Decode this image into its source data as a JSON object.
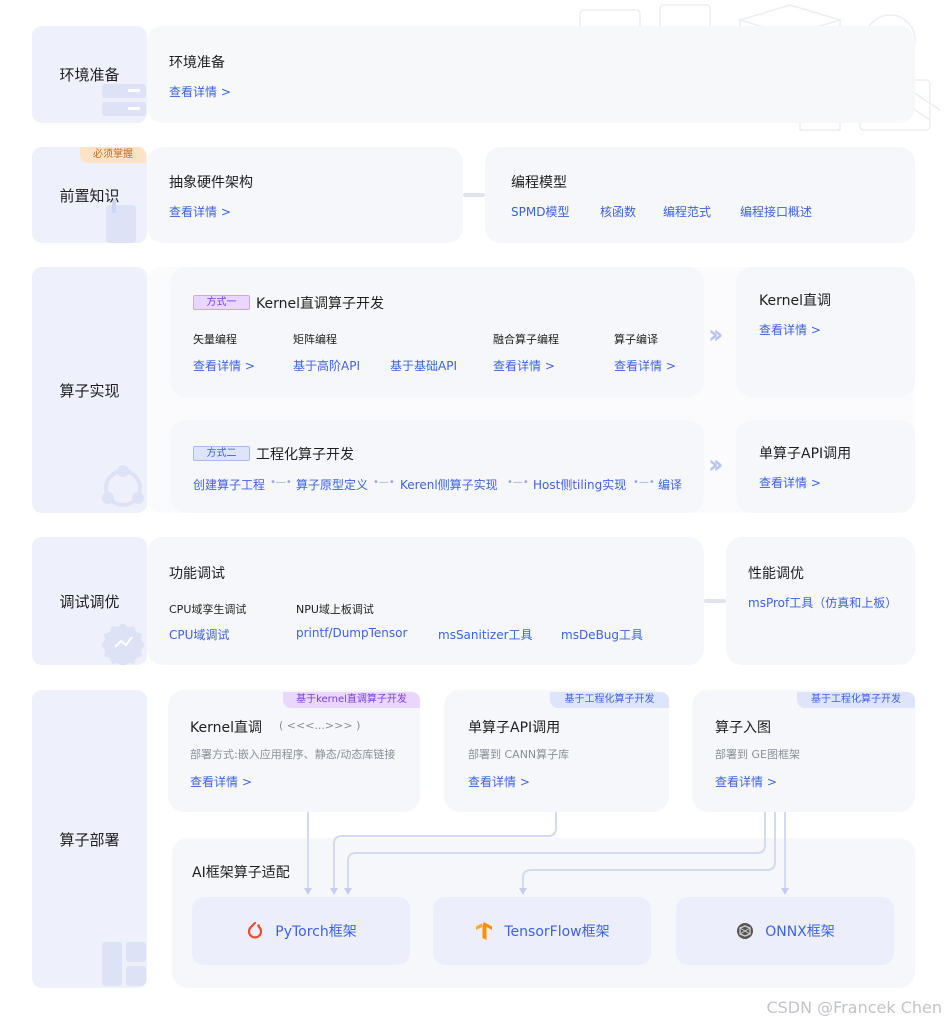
{
  "sections": {
    "env": "环境准备",
    "prereq": "前置知识",
    "impl": "算子实现",
    "debug": "调试调优",
    "deploy": "算子部署"
  },
  "env": {
    "title": "环境准备",
    "link": "查看详情  >"
  },
  "prereq": {
    "tag": "必须掌握",
    "hw_title": "抽象硬件架构",
    "hw_link": "查看详情  >",
    "model_title": "编程模型",
    "model_links": [
      "SPMD模型",
      "核函数",
      "编程范式",
      "编程接口概述"
    ]
  },
  "impl": {
    "way1_badge": "方式一",
    "way1_title": "Kernel直调算子开发",
    "way1_cols": [
      {
        "label": "矢量编程",
        "link": "查看详情  >"
      },
      {
        "label": "矩阵编程",
        "link": "基于高阶API"
      },
      {
        "label": "",
        "link": "基于基础API"
      },
      {
        "label": "融合算子编程",
        "link": "查看详情  >"
      },
      {
        "label": "算子编译",
        "link": "查看详情  >"
      }
    ],
    "way2_badge": "方式二",
    "way2_title": "工程化算子开发",
    "way2_flow": [
      "创建算子工程",
      "算子原型定义",
      "Kerenl侧算子实现",
      "Host侧tiling实现",
      "编译"
    ],
    "kernel_title": "Kernel直调",
    "kernel_link": "查看详情  >",
    "single_title": "单算子API调用",
    "single_link": "查看详情  >"
  },
  "debug": {
    "func_title": "功能调试",
    "cpu_label": "CPU域孪生调试",
    "npu_label": "NPU域上板调试",
    "links": [
      "CPU域调试",
      "printf/DumpTensor",
      "msSanitizer工具",
      "msDeBug工具"
    ],
    "perf_title": "性能调优",
    "perf_link": "msProf工具（仿真和上板）"
  },
  "deploy": {
    "cards": [
      {
        "tag": "基于kernel直调算子开发",
        "title": "Kernel直调",
        "extra": "( <<<...>>> )",
        "desc": "部署方式:嵌入应用程序、静态/动态库链接",
        "link": "查看详情  >"
      },
      {
        "tag": "基于工程化算子开发",
        "title": "单算子API调用",
        "extra": "",
        "desc": "部署到 CANN算子库",
        "link": "查看详情  >"
      },
      {
        "tag": "基于工程化算子开发",
        "title": "算子入图",
        "extra": "",
        "desc": "部署到 GE图框架",
        "link": "查看详情  >"
      }
    ],
    "ai_title": "AI框架算子适配",
    "frameworks": [
      {
        "name": "PyTorch框架",
        "icon": "pytorch-icon"
      },
      {
        "name": "TensorFlow框架",
        "icon": "tensorflow-icon"
      },
      {
        "name": "ONNX框架",
        "icon": "onnx-icon"
      }
    ]
  },
  "watermark": "CSDN @Francek Chen",
  "colors": {
    "link": "#3d62e6",
    "label_bg": "#eef0fb",
    "panel_bg": "#f6f7fa",
    "purple": "#7b3fd6",
    "orange_tag": "#fde3c6"
  }
}
